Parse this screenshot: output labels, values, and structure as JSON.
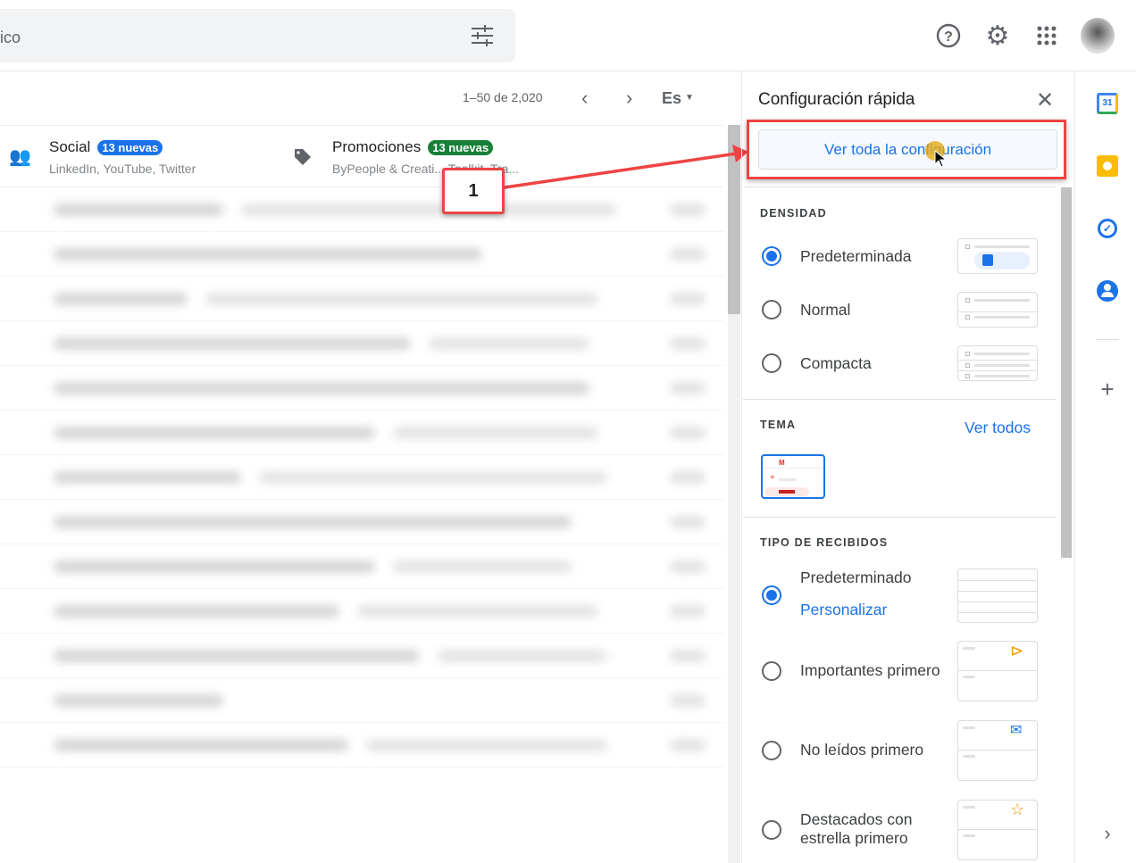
{
  "search": {
    "partial_text": "ico",
    "filter_icon": "tune-icon"
  },
  "header": {
    "icons": [
      "help-icon",
      "gear-icon",
      "apps-grid-icon",
      "avatar"
    ]
  },
  "toolbar": {
    "pagination": "1–50 de 2,020",
    "prev": "‹",
    "next": "›",
    "input_tool": "Es"
  },
  "tabs": [
    {
      "title": "Social",
      "badge": "13 nuevas",
      "badge_color": "#1a73e8",
      "subtitle": "LinkedIn, YouTube, Twitter",
      "icon": "people-icon"
    },
    {
      "title": "Promociones",
      "badge": "13 nuevas",
      "badge_color": "#188038",
      "subtitle": "ByPeople & Creati... Toolkit, Tra...",
      "icon": "tag-icon"
    }
  ],
  "annotation": {
    "label": "1",
    "color": "#ef4444"
  },
  "panel": {
    "title": "Configuración rápida",
    "close": "✕",
    "all_settings": "Ver toda la configuración",
    "density": {
      "heading": "DENSIDAD",
      "options": [
        {
          "label": "Predeterminada",
          "selected": true
        },
        {
          "label": "Normal",
          "selected": false
        },
        {
          "label": "Compacta",
          "selected": false
        }
      ]
    },
    "theme": {
      "heading": "TEMA",
      "see_all": "Ver todos"
    },
    "inbox": {
      "heading": "TIPO DE RECIBIDOS",
      "customize": "Personalizar",
      "options": [
        {
          "label": "Predeterminado",
          "selected": true
        },
        {
          "label": "Importantes primero",
          "selected": false
        },
        {
          "label": "No leídos primero",
          "selected": false
        },
        {
          "label": "Destacados con estrella primero",
          "selected": false
        }
      ]
    }
  },
  "side_rail": [
    "calendar-icon",
    "keep-icon",
    "tasks-icon",
    "contacts-icon",
    "add-icon",
    "expand-icon"
  ],
  "colors": {
    "accent": "#1a73e8",
    "annotation": "#ef4444"
  }
}
